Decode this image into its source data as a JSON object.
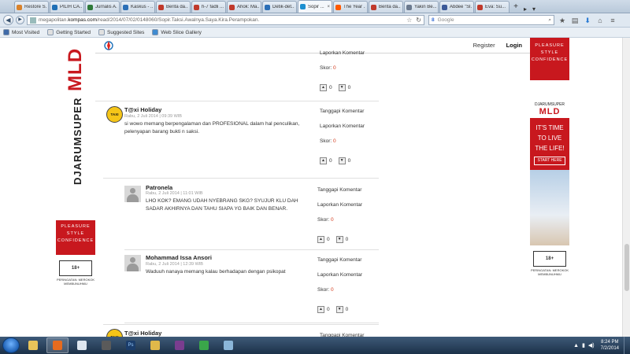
{
  "browser": {
    "tabs": [
      {
        "label": "Restore S...",
        "color": "#d9822b"
      },
      {
        "label": "PILIH CA...",
        "color": "#1f6fb5"
      },
      {
        "label": "Jurnalis A...",
        "color": "#2f7a3a"
      },
      {
        "label": "Kaskus - ...",
        "color": "#2b6fb7"
      },
      {
        "label": "Berita da...",
        "color": "#c0392b"
      },
      {
        "label": "h-7 fadli ...",
        "color": "#c0392b"
      },
      {
        "label": "Ahok: Ma...",
        "color": "#c0392b"
      },
      {
        "label": "Detik-det...",
        "color": "#2b6fb7"
      },
      {
        "label": "Sopir ...",
        "color": "#1d8fd0",
        "active": true
      },
      {
        "label": "The Year ...",
        "color": "#ff5a00"
      },
      {
        "label": "Berita da...",
        "color": "#c0392b"
      },
      {
        "label": "Yakin Be...",
        "color": "#6b7a8f"
      },
      {
        "label": "Abdee \"Sl...",
        "color": "#3b5998"
      },
      {
        "label": "Eva: Su...",
        "color": "#c0392b"
      }
    ],
    "url_prefix": "megapolitan.",
    "url_domain": "kompas.com",
    "url_path": "/read/2014/07/02/0148060/Sopir.Taksi.Awalnya.Saya.Kira.Perampokan.",
    "search_placeholder": "Google",
    "search_engine_glyph": "8",
    "bookmarks": [
      {
        "label": "Most Visited",
        "color": "#3f6aa8"
      },
      {
        "label": "Getting Started",
        "color": "#e0e0e0"
      },
      {
        "label": "Suggested Sites",
        "color": "#e0e0e0"
      },
      {
        "label": "Web Slice Gallery",
        "color": "#3f8bd1"
      }
    ]
  },
  "site": {
    "register_label": "Register",
    "login_label": "Login"
  },
  "ads": {
    "left": {
      "slogan": [
        "PLEASURE",
        "STYLE",
        "CONFIDENCE"
      ],
      "brand": "DJARUMSUPER",
      "brand_sub": "MLD",
      "warning": "PERINGATAN: MEROKOK MEMBUNUHMU",
      "age": "18+"
    },
    "right": {
      "slogan": [
        "PLEASURE",
        "STYLE",
        "CONFIDENCE"
      ],
      "brand": "DJARUMSUPER",
      "brand_sub": "MLD",
      "tagline": [
        "IT'S TIME",
        "TO LIVE",
        "THE LIFE!"
      ],
      "start_here": "START HERE",
      "warning": "PERINGATAN: MEROKOK MEMBUNUHMU",
      "age": "18+"
    }
  },
  "actions": {
    "reply": "Tanggapi Komentar",
    "report": "Laporkan Komentar",
    "score_label": "Skor:"
  },
  "comments": [
    {
      "partial_top": true,
      "score": "0",
      "up": "0",
      "down": "0"
    },
    {
      "avatar": "TAXI",
      "name": "T@xi Holiday",
      "date": "Rabu, 2 Juli 2014 | 09:39 WIB",
      "text": "si wowo memang berpengalaman dan PROFESIONAL dalam hal penculikan, pelenyapan barang bukti n saksi.",
      "score": "0",
      "up": "0",
      "down": "0"
    },
    {
      "name": "Patronela",
      "date": "Rabu, 2 Juli 2014 | 11:01 WIB",
      "text": "LHO KOK? EMANG UDAH NYEBRANG SKG? SYUJUR KLU DAH SADAR AKHIRNYA DAN TAHU SIAPA YG BAIK DAN BENAR.",
      "score": "0",
      "up": "0",
      "down": "0"
    },
    {
      "name": "Mohammad Issa Ansori",
      "date": "Rabu, 2 Juli 2014 | 12:39 WIB",
      "text": "Waduuh nanaya memang kalau berhadapan dengan psikopat",
      "score": "0",
      "up": "0",
      "down": "0"
    },
    {
      "avatar": "TAXI",
      "name": "T@xi Holiday"
    }
  ],
  "taskbar": {
    "time": "8:24 PM",
    "date": "7/2/2014",
    "apps": [
      {
        "name": "explorer",
        "color": "#e8c45a"
      },
      {
        "name": "firefox",
        "color": "#e66b1f",
        "selected": true
      },
      {
        "name": "notepad",
        "color": "#dfe7f0"
      },
      {
        "name": "app",
        "color": "#5a5a5a"
      },
      {
        "name": "photoshop",
        "color": "#1b3d6b",
        "label": "Ps"
      },
      {
        "name": "folder",
        "color": "#e0b84a"
      },
      {
        "name": "winrar",
        "color": "#7a3d8f"
      },
      {
        "name": "chrome",
        "color": "#3aa64a"
      },
      {
        "name": "screen",
        "color": "#8bb6d9"
      }
    ]
  }
}
